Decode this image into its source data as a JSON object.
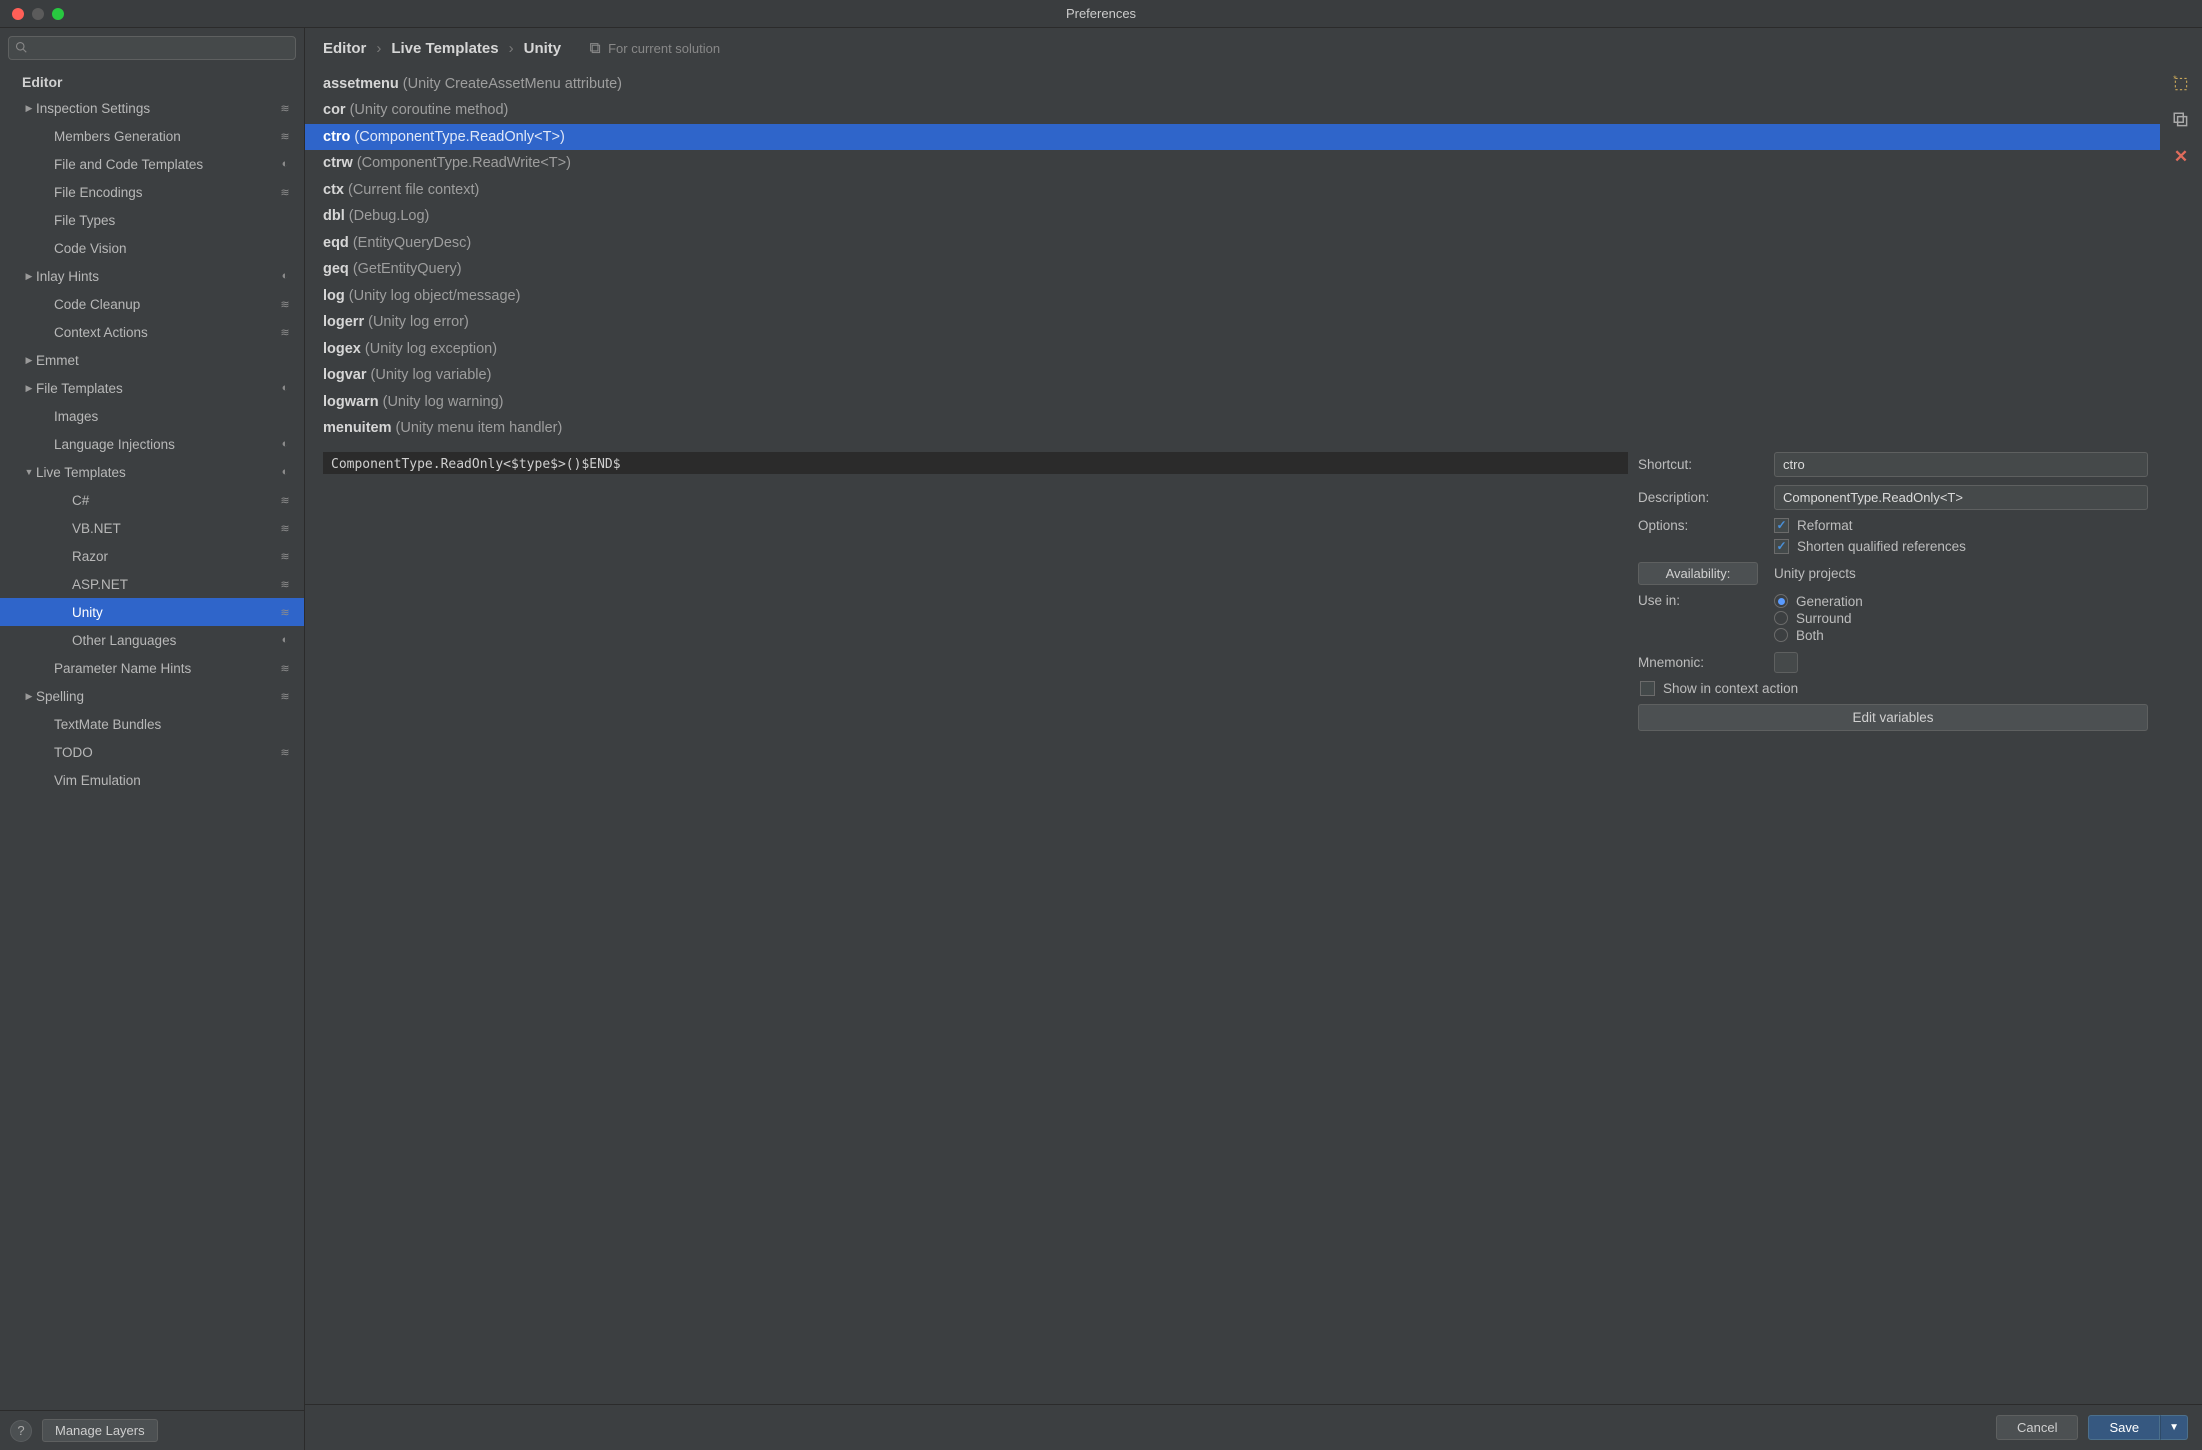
{
  "window_title": "Preferences",
  "sidebar": {
    "search_placeholder": "",
    "heading": "Editor",
    "items": [
      {
        "label": "Inspection Settings",
        "indent": 1,
        "expander": "▶",
        "badge": "stack"
      },
      {
        "label": "Members Generation",
        "indent": 2,
        "badge": "stack"
      },
      {
        "label": "File and Code Templates",
        "indent": 2,
        "badge": "drop"
      },
      {
        "label": "File Encodings",
        "indent": 2,
        "badge": "stack"
      },
      {
        "label": "File Types",
        "indent": 2
      },
      {
        "label": "Code Vision",
        "indent": 2
      },
      {
        "label": "Inlay Hints",
        "indent": 1,
        "expander": "▶",
        "badge": "drop"
      },
      {
        "label": "Code Cleanup",
        "indent": 2,
        "badge": "stack"
      },
      {
        "label": "Context Actions",
        "indent": 2,
        "badge": "stack"
      },
      {
        "label": "Emmet",
        "indent": 1,
        "expander": "▶"
      },
      {
        "label": "File Templates",
        "indent": 1,
        "expander": "▶",
        "badge": "drop"
      },
      {
        "label": "Images",
        "indent": 2
      },
      {
        "label": "Language Injections",
        "indent": 2,
        "badge": "drop"
      },
      {
        "label": "Live Templates",
        "indent": 1,
        "expander": "▼",
        "badge": "drop"
      },
      {
        "label": "C#",
        "indent": 3,
        "badge": "stack"
      },
      {
        "label": "VB.NET",
        "indent": 3,
        "badge": "stack"
      },
      {
        "label": "Razor",
        "indent": 3,
        "badge": "stack"
      },
      {
        "label": "ASP.NET",
        "indent": 3,
        "badge": "stack"
      },
      {
        "label": "Unity",
        "indent": 3,
        "badge": "stack",
        "selected": true
      },
      {
        "label": "Other Languages",
        "indent": 3,
        "badge": "drop"
      },
      {
        "label": "Parameter Name Hints",
        "indent": 2,
        "badge": "stack"
      },
      {
        "label": "Spelling",
        "indent": 1,
        "expander": "▶",
        "badge": "stack"
      },
      {
        "label": "TextMate Bundles",
        "indent": 2
      },
      {
        "label": "TODO",
        "indent": 2,
        "badge": "stack"
      },
      {
        "label": "Vim Emulation",
        "indent": 2
      }
    ],
    "manage_layers": "Manage Layers"
  },
  "breadcrumb": [
    "Editor",
    "Live Templates",
    "Unity"
  ],
  "for_current_solution": "For current solution",
  "templates": [
    {
      "abbr": "assetmenu",
      "desc": "(Unity CreateAssetMenu attribute)"
    },
    {
      "abbr": "cor",
      "desc": "(Unity coroutine method)"
    },
    {
      "abbr": "ctro",
      "desc": "(ComponentType.ReadOnly<T>)",
      "selected": true
    },
    {
      "abbr": "ctrw",
      "desc": "(ComponentType.ReadWrite<T>)"
    },
    {
      "abbr": "ctx",
      "desc": "(Current file context)"
    },
    {
      "abbr": "dbl",
      "desc": "(Debug.Log)"
    },
    {
      "abbr": "eqd",
      "desc": "(EntityQueryDesc)"
    },
    {
      "abbr": "geq",
      "desc": "(GetEntityQuery)"
    },
    {
      "abbr": "log",
      "desc": "(Unity log object/message)"
    },
    {
      "abbr": "logerr",
      "desc": "(Unity log error)"
    },
    {
      "abbr": "logex",
      "desc": "(Unity log exception)"
    },
    {
      "abbr": "logvar",
      "desc": "(Unity log variable)"
    },
    {
      "abbr": "logwarn",
      "desc": "(Unity log warning)"
    },
    {
      "abbr": "menuitem",
      "desc": "(Unity menu item handler)"
    }
  ],
  "code": "ComponentType.ReadOnly<$type$>()$END$",
  "form": {
    "shortcut_label": "Shortcut:",
    "shortcut_value": "ctro",
    "description_label": "Description:",
    "description_value": "ComponentType.ReadOnly<T>",
    "options_label": "Options:",
    "reformat": "Reformat",
    "shorten": "Shorten qualified references",
    "availability_btn": "Availability:",
    "availability_text": "Unity projects",
    "usein_label": "Use in:",
    "usein_generation": "Generation",
    "usein_surround": "Surround",
    "usein_both": "Both",
    "mnemonic_label": "Mnemonic:",
    "show_context": "Show in context action",
    "edit_variables": "Edit variables"
  },
  "footer": {
    "cancel": "Cancel",
    "save": "Save"
  }
}
